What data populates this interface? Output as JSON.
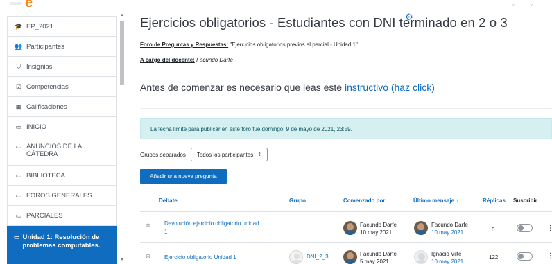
{
  "header": {
    "logo_text": "e",
    "top_right_icons": [
      "dots-icon",
      "chevron-down-icon"
    ]
  },
  "sidebar": {
    "items": [
      {
        "label": "EP_2021",
        "icon": "graduation-cap-icon",
        "glyph": "🎓"
      },
      {
        "label": "Participantes",
        "icon": "users-icon",
        "glyph": "👥"
      },
      {
        "label": "Insignias",
        "icon": "shield-icon",
        "glyph": "⛉"
      },
      {
        "label": "Competencias",
        "icon": "check-square-icon",
        "glyph": "☑"
      },
      {
        "label": "Calificaciones",
        "icon": "table-icon",
        "glyph": "▦"
      },
      {
        "label": "INICIO",
        "icon": "folder-icon",
        "glyph": "▭"
      },
      {
        "label": "ANUNCIOS DE LA CÁTEDRA",
        "icon": "folder-icon",
        "glyph": "▭"
      },
      {
        "label": "BIBLIOTECA",
        "icon": "folder-icon",
        "glyph": "▭"
      },
      {
        "label": "FOROS GENERALES",
        "icon": "folder-icon",
        "glyph": "▭"
      },
      {
        "label": "PARCIALES",
        "icon": "folder-icon",
        "glyph": "▭"
      },
      {
        "label": "Unidad 1: Resolución de problemas computables.",
        "icon": "folder-icon",
        "glyph": "▭",
        "active": true
      }
    ]
  },
  "main": {
    "title": "Ejercicios obligatorios - Estudiantes con DNI terminado en 2 o 3",
    "forum_label": "Foro de Preguntas y Respuestas:",
    "forum_value": "\"Ejercicios obligatorios previos al parcial - Unidad 1\"",
    "teacher_label": "A cargo del docente:",
    "teacher_value": "Facundo Darfe",
    "intro_text": "Antes de comenzar es necesario que leas este",
    "intro_link": "instructivo (haz click)",
    "deadline_alert": "La fecha límite para publicar en este foro fue domingo, 9 de mayo de 2021, 23:59.",
    "groups_label": "Grupos separados",
    "groups_select": "Todos los participantes",
    "add_button": "Añadir una nueva pregunta"
  },
  "table": {
    "headers": {
      "debate": "Debate",
      "grupo": "Grupo",
      "comenzado": "Comenzado por",
      "ultimo": "Último mensaje ↓",
      "replicas": "Réplicas",
      "suscribir": "Suscribir"
    },
    "rows": [
      {
        "topic_line1": "Devolución ejercicio obligatorio unidad",
        "topic_line2": "1",
        "group": "",
        "started_name": "Facundo Darfe",
        "started_date": "10 may 2021",
        "last_name": "Facundo Darfe",
        "last_date": "10 may 2021",
        "replies": "0",
        "subscribed": false
      },
      {
        "topic_line1": "Ejercicio obligatorio Unidad 1",
        "topic_line2": "",
        "group": "DNI_2_3",
        "started_name": "Facundo Darfe",
        "started_date": "5 may 2021",
        "last_name": "Ignacio Vilte",
        "last_date": "10 may 2021",
        "replies": "122",
        "subscribed": false
      }
    ]
  },
  "colors": {
    "primary": "#0f6cbf",
    "alert_bg": "#d6f0f2",
    "logo": "#f98012"
  }
}
